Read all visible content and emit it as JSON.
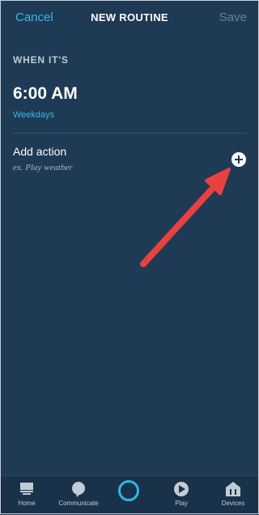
{
  "header": {
    "cancel_label": "Cancel",
    "title": "NEW ROUTINE",
    "save_label": "Save"
  },
  "trigger": {
    "section_label": "WHEN IT'S",
    "time": "6:00 AM",
    "recurrence": "Weekdays"
  },
  "action": {
    "label": "Add action",
    "example": "ex. Play weather"
  },
  "annotation": {
    "arrow_color": "#e8413f"
  },
  "navbar": {
    "items": [
      {
        "label": "Home",
        "icon": "home-icon"
      },
      {
        "label": "Communicate",
        "icon": "speech-bubble-icon"
      },
      {
        "label": "",
        "icon": "alexa-ring-icon"
      },
      {
        "label": "Play",
        "icon": "play-icon"
      },
      {
        "label": "Devices",
        "icon": "devices-icon"
      }
    ]
  },
  "colors": {
    "background": "#1e3a55",
    "accent": "#38b7e6",
    "disabled": "#6b8296"
  }
}
